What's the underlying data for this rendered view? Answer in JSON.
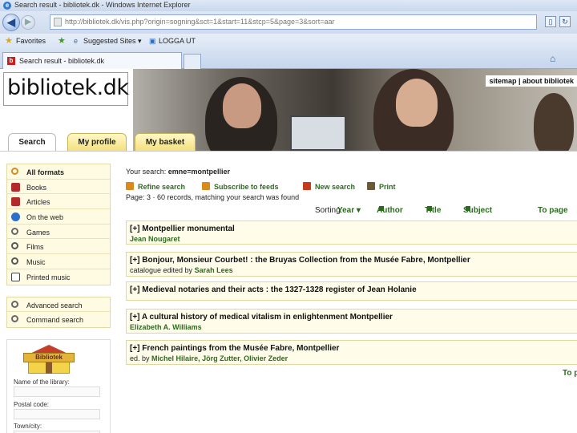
{
  "browser": {
    "window_title": "Search result - bibliotek.dk - Windows Internet Explorer",
    "url": "http://bibliotek.dk/vis.php?origin=sogning&sct=1&start=11&stcp=5&page=3&sort=aar",
    "favorites_label": "Favorites",
    "suggested_sites_label": "Suggested Sites ▾",
    "login_label": "LOGGA UT",
    "tab_title": "Search result - bibliotek.dk"
  },
  "site": {
    "logo_text": "bibliotek.dk",
    "top_links": "sitemap | about bibliotek",
    "tabs": [
      {
        "label": "Search"
      },
      {
        "label": "My profile"
      },
      {
        "label": "My basket"
      }
    ]
  },
  "sidebar": {
    "formats": [
      {
        "label": "All formats",
        "icon": "magnifier-icon",
        "color": "#d98a1c"
      },
      {
        "label": "Books",
        "icon": "book-icon",
        "color": "#b22a2a"
      },
      {
        "label": "Articles",
        "icon": "article-icon",
        "color": "#b22a2a"
      },
      {
        "label": "On the web",
        "icon": "globe-icon",
        "color": "#2a6fc9"
      },
      {
        "label": "Games",
        "icon": "game-icon",
        "color": "#666666"
      },
      {
        "label": "Films",
        "icon": "film-icon",
        "color": "#555555"
      },
      {
        "label": "Music",
        "icon": "music-icon",
        "color": "#555555"
      },
      {
        "label": "Printed music",
        "icon": "sheet-music-icon",
        "color": "#444444"
      }
    ],
    "search_links": [
      {
        "label": "Advanced search"
      },
      {
        "label": "Command search"
      }
    ],
    "library": {
      "house_text": "Bibliotek",
      "name_label": "Name of the library:",
      "postal_label": "Postal code:",
      "town_label": "Town/city:"
    }
  },
  "results": {
    "your_search_label": "Your search:",
    "your_search_value": "emne=montpellier",
    "actions": [
      {
        "label": "Refine search",
        "icon": "funnel-icon",
        "color": "#d98a1c"
      },
      {
        "label": "Subscribe to feeds",
        "icon": "feed-icon",
        "color": "#d98a1c"
      },
      {
        "label": "New search",
        "icon": "new-search-icon",
        "color": "#c43a1a"
      },
      {
        "label": "Print",
        "icon": "print-icon",
        "color": "#6a5a3a"
      }
    ],
    "count_text": "Page: 3 · 60 records, matching your search was found",
    "sorting_label": "Sorting:",
    "sort_options": [
      "Year ▾",
      "Author",
      "Title",
      "Subject"
    ],
    "to_page_label": "To page",
    "items": [
      {
        "title": "[+] Montpellier monumental",
        "sub_prefix": "",
        "sub": "Jean Nougaret"
      },
      {
        "title": "[+] Bonjour, Monsieur Courbet! : the Bruyas Collection from the Musée Fabre, Montpellier",
        "sub_prefix": "catalogue edited by",
        "sub": "Sarah Lees"
      },
      {
        "title": "[+] Medieval notaries and their acts : the 1327-1328 register of Jean Holanie",
        "sub_prefix": "",
        "sub": ""
      },
      {
        "title": "[+] A cultural history of medical vitalism in enlightenment Montpellier",
        "sub_prefix": "",
        "sub": "Elizabeth A. Williams"
      },
      {
        "title": "[+] French paintings from the Musée Fabre, Montpellier",
        "sub_prefix": "ed. by",
        "sub": "Michel Hilaire, Jörg Zutter, Olivier Zeder"
      }
    ],
    "to_page_bottom": "To p"
  }
}
